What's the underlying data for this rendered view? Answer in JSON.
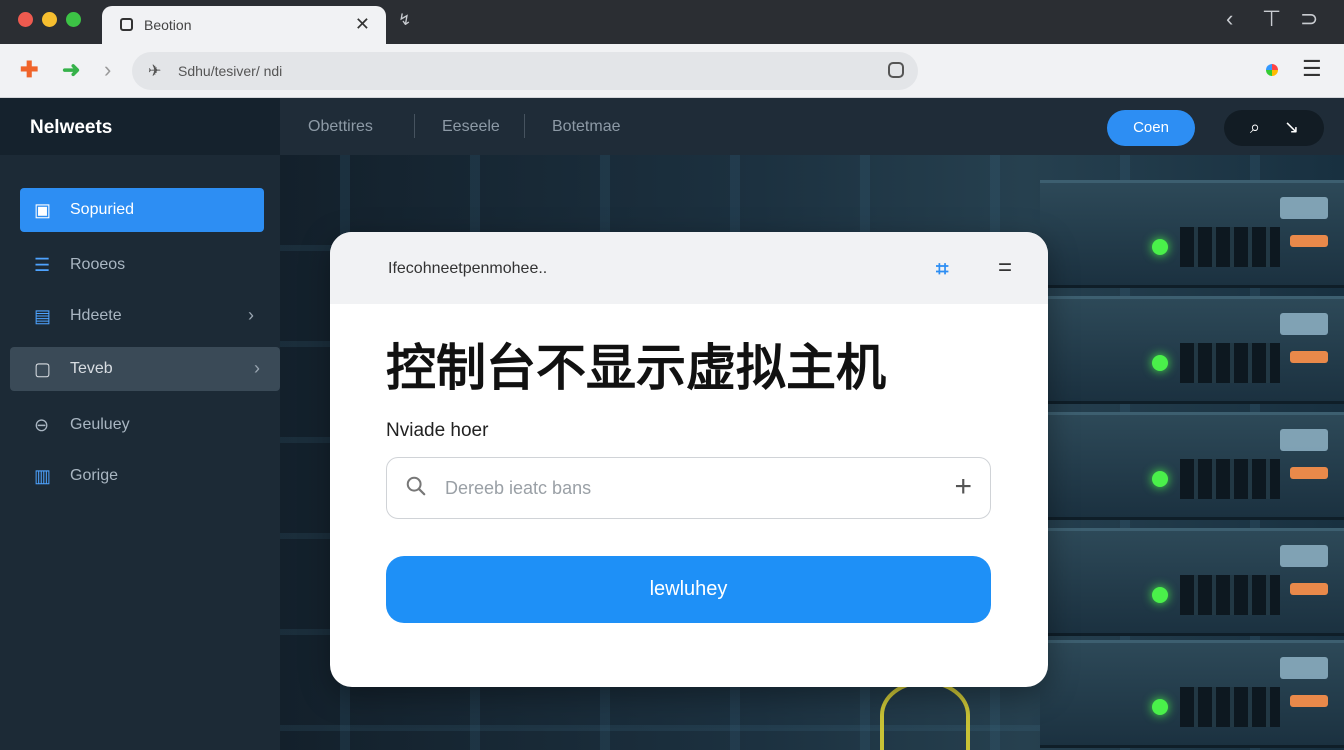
{
  "browser": {
    "tab_title": "Beotion",
    "tab_close": "✕",
    "new_tab_icon": "↯",
    "url": "Sdhu/tesiver/ ndi",
    "back_icon": "arrow-left-icon",
    "forward_icon": "arrow-right-icon",
    "controls": [
      "‹",
      "⊤",
      "⊃"
    ]
  },
  "sidebar": {
    "title": "Nelweets",
    "items": [
      {
        "label": "Sopuried",
        "icon": "folder-icon",
        "active": true
      },
      {
        "label": "Rooeos",
        "icon": "list-icon"
      },
      {
        "label": "Hdeete",
        "icon": "server-icon",
        "has_arrow": true
      },
      {
        "label": "Teveb",
        "icon": "box-icon",
        "has_arrow": true,
        "hover": true
      },
      {
        "label": "Geuluey",
        "icon": "link-icon"
      },
      {
        "label": "Gorige",
        "icon": "chart-icon"
      }
    ]
  },
  "topbar": {
    "nav": [
      "Obettires",
      "Eeseele",
      "Botetmae"
    ],
    "open_button": "Coen"
  },
  "card": {
    "header_text": "Ifecohneetpenmohee..",
    "headline": "控制台不显示虚拟主机",
    "field_label": "Nviade hoer",
    "search_placeholder": "Dereeb ieatc bans",
    "primary_button": "lewluhey"
  },
  "colors": {
    "accent": "#1e90f7",
    "sidebar_bg": "#1c2a36",
    "topbar_bg": "#1f2c38"
  }
}
